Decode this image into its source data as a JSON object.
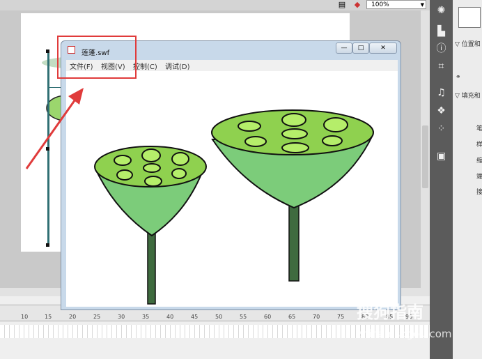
{
  "toolbar": {
    "zoom_value": "100%"
  },
  "window": {
    "title": "莲蓬.swf",
    "minimize": "—",
    "maximize": "□",
    "close": "✕",
    "menu": [
      "文件(F)",
      "视图(V)",
      "控制(C)",
      "调试(D)"
    ]
  },
  "timeline": {
    "ticks": [
      "10",
      "15",
      "20",
      "25",
      "30",
      "35",
      "40",
      "45",
      "50",
      "55",
      "60",
      "65",
      "70",
      "75",
      "80",
      "85",
      "90"
    ]
  },
  "properties": {
    "sections": [
      "位置和",
      "填充和"
    ],
    "rows": [
      "笔",
      "样",
      "缩",
      "端",
      "接"
    ]
  },
  "watermark": {
    "brand": "搜狗指南",
    "url": "zhinan.sogou.com"
  },
  "colors": {
    "seed_fill": "#8fd14f",
    "pod_fill": "#7ccc7a",
    "stem": "#3f6b3f",
    "highlight": "#e03b3b"
  }
}
